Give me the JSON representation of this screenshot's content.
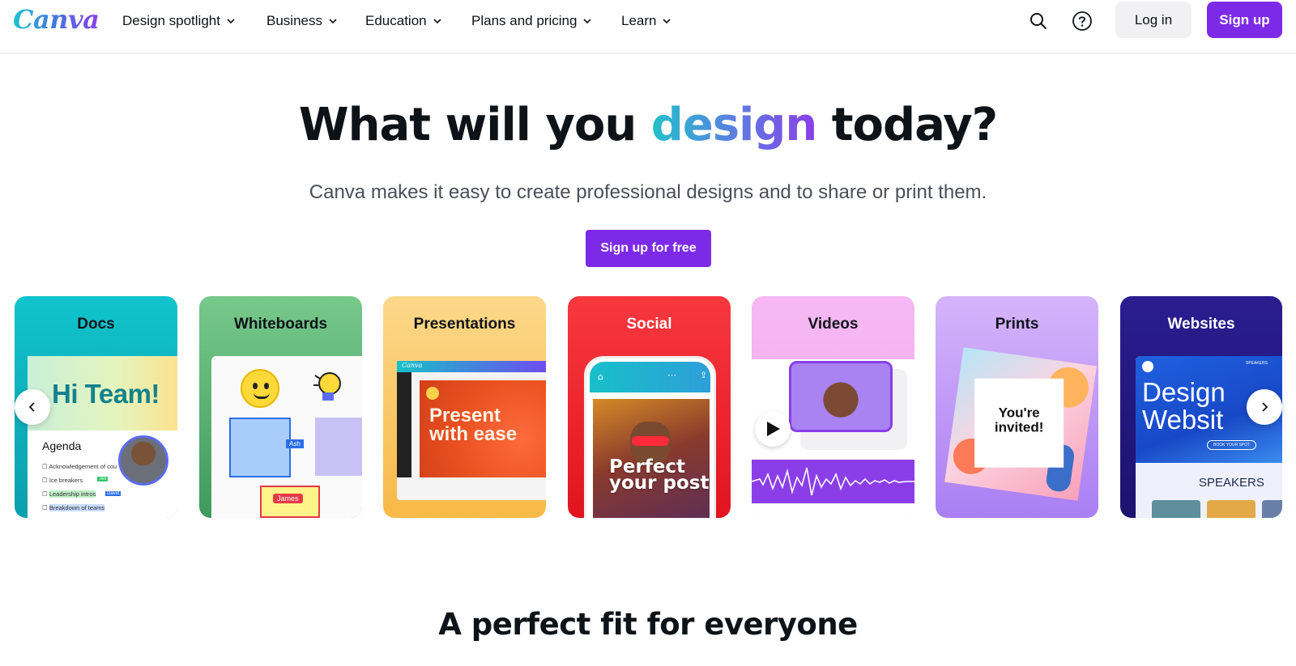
{
  "header": {
    "logo": "Canva",
    "nav": [
      {
        "label": "Design spotlight"
      },
      {
        "label": "Business"
      },
      {
        "label": "Education"
      },
      {
        "label": "Plans and pricing"
      },
      {
        "label": "Learn"
      }
    ],
    "login_label": "Log in",
    "signup_label": "Sign up"
  },
  "hero": {
    "title_before": "What will you ",
    "title_highlight": "design",
    "title_after": " today?",
    "subtitle": "Canva makes it easy to create professional designs and to share or print them.",
    "cta_label": "Sign up for free"
  },
  "cards": [
    {
      "label": "Docs",
      "color": "#13b8c6",
      "preview": {
        "heading": "Hi Team!",
        "agenda": "Agenda",
        "items": [
          "Acknowledgement of cou",
          "Ice breakers",
          "Leadership intros",
          "Breakdown of teams"
        ],
        "tags": [
          "Tex",
          "David"
        ]
      }
    },
    {
      "label": "Whiteboards",
      "color": "#6dc47f",
      "preview": {
        "tags": [
          "Ash",
          "James"
        ]
      }
    },
    {
      "label": "Presentations",
      "color": "#fbd27a",
      "preview": {
        "app": "Canva",
        "text": "Present with ease"
      }
    },
    {
      "label": "Social",
      "color": "#f5353b",
      "preview": {
        "text": "Perfect your post"
      }
    },
    {
      "label": "Videos",
      "color": "#f4b7f1"
    },
    {
      "label": "Prints",
      "color": "#c3a5f8",
      "preview": {
        "text": "You're invited!"
      }
    },
    {
      "label": "Websites",
      "color": "#2a1a8c",
      "preview": {
        "text": "Design Websit",
        "speakers": "SPEAKERS",
        "nav": "SPEAKERS",
        "button": "BOOK YOUR SPOT"
      }
    }
  ],
  "section2": {
    "title": "A perfect fit for everyone"
  },
  "colors": {
    "brand_purple": "#7d2ae8",
    "teal": "#22c1c9"
  }
}
